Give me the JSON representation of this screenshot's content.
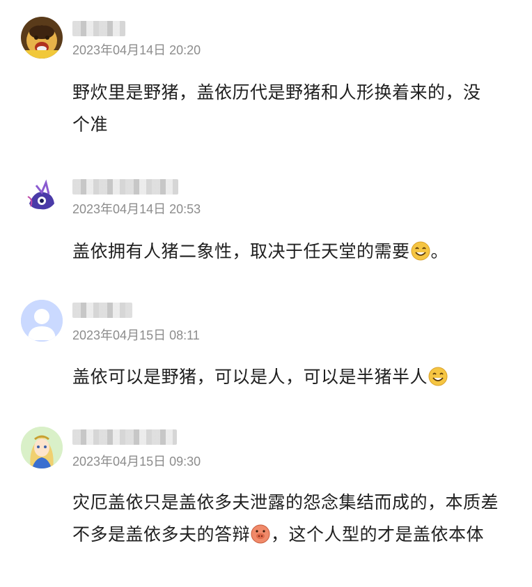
{
  "comments": [
    {
      "avatar": "cartoon-laughing-face",
      "time": "2023年04月14日 20:20",
      "text": "野炊里是野猪，盖依历代是野猪和人形换着来的，没个准",
      "emoji": null
    },
    {
      "avatar": "purple-creature",
      "time": "2023年04月14日 20:53",
      "text": "盖依拥有人猪二象性，取决于任天堂的需要",
      "emoji": "grin-emoji",
      "after_emoji": "。"
    },
    {
      "avatar": "default-user",
      "time": "2023年04月15日 08:11",
      "text": "盖依可以是野猪，可以是人，可以是半猪半人",
      "emoji": "grin-emoji",
      "after_emoji": ""
    },
    {
      "avatar": "anime-girl",
      "time": "2023年04月15日 09:30",
      "text_part1": "灾厄盖依只是盖依多夫泄露的怨念集结而成的，本质差不多是盖依多夫的答辩",
      "emoji": "pig-emoji",
      "text_part2": "，这个人型的才是盖依本体"
    }
  ]
}
